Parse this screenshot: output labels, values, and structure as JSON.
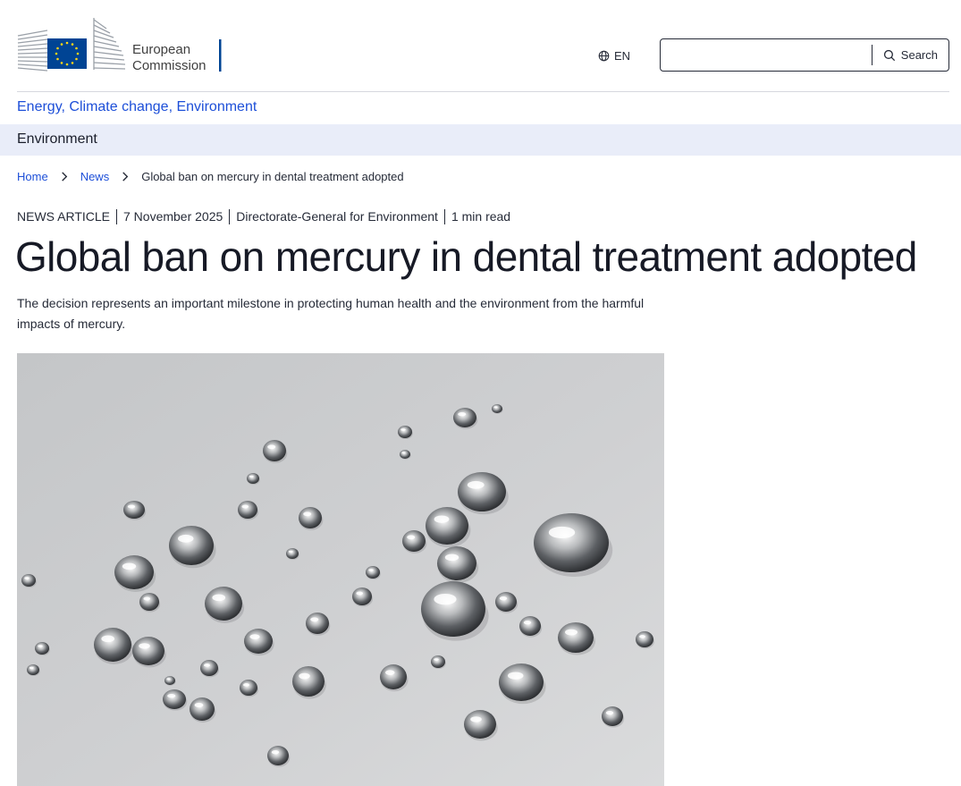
{
  "header": {
    "logo": {
      "line1": "European",
      "line2": "Commission",
      "accent": "#004494",
      "star_color": "#ffd617"
    },
    "language": {
      "icon": "globe-icon",
      "label": "EN"
    },
    "search": {
      "placeholder": "",
      "value": "",
      "button_label": "Search",
      "icon": "search-icon"
    }
  },
  "site": {
    "name": "Energy, Climate change, Environment"
  },
  "section": {
    "name": "Environment"
  },
  "breadcrumb": {
    "items": [
      {
        "label": "Home"
      },
      {
        "label": "News"
      },
      {
        "label": "Global ban on mercury in dental treatment adopted"
      }
    ]
  },
  "article": {
    "type": "NEWS ARTICLE",
    "date": "7 November 2025",
    "department": "Directorate-General for Environment",
    "reading_time": "1 min read",
    "title": "Global ban on mercury in dental treatment adopted",
    "lead": "The decision represents an important milestone in protecting human health and the environment from the harmful impacts of mercury.",
    "image": {
      "subject": "mercury droplets"
    }
  },
  "colors": {
    "link": "#1d4fd8",
    "section_bar": "#e9edf9",
    "text": "#262b38"
  }
}
